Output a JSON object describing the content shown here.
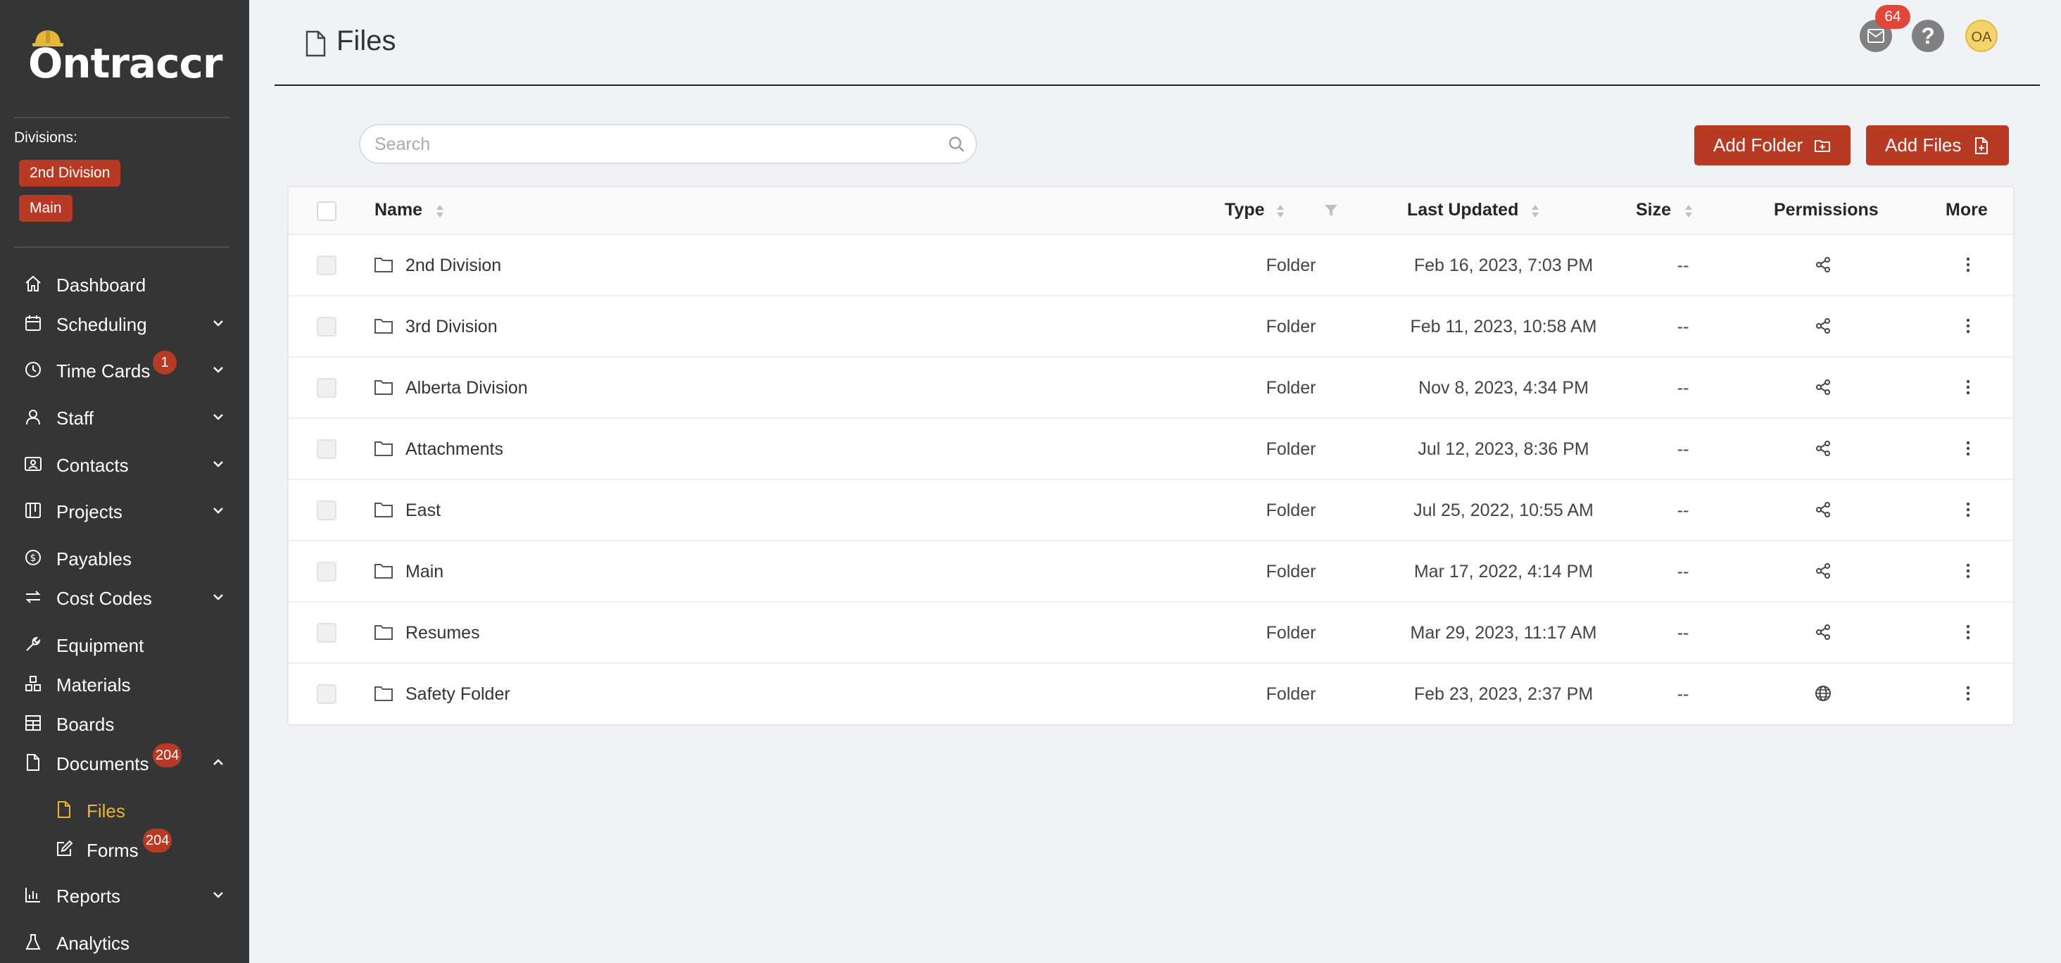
{
  "app": {
    "logo_text": "Ontraccr"
  },
  "sidebar": {
    "divisions_label": "Divisions:",
    "division_tags": [
      "2nd Division",
      "Main"
    ],
    "items": [
      {
        "label": "Dashboard",
        "icon": "home-icon"
      },
      {
        "label": "Scheduling",
        "icon": "calendar-icon"
      },
      {
        "label": "Time Cards",
        "icon": "clock-icon",
        "badge": "1"
      },
      {
        "label": "Staff",
        "icon": "user-icon"
      },
      {
        "label": "Contacts",
        "icon": "contacts-icon"
      },
      {
        "label": "Projects",
        "icon": "projects-icon"
      },
      {
        "label": "Payables",
        "icon": "dollar-icon"
      },
      {
        "label": "Cost Codes",
        "icon": "swap-icon"
      },
      {
        "label": "Equipment",
        "icon": "wrench-icon"
      },
      {
        "label": "Materials",
        "icon": "materials-icon"
      },
      {
        "label": "Boards",
        "icon": "boards-icon"
      },
      {
        "label": "Documents",
        "icon": "document-icon",
        "badge": "204"
      },
      {
        "label": "Files",
        "icon": "file-icon",
        "active": true
      },
      {
        "label": "Forms",
        "icon": "edit-form-icon",
        "badge": "204"
      },
      {
        "label": "Reports",
        "icon": "bar-chart-icon"
      },
      {
        "label": "Analytics",
        "icon": "flask-icon"
      }
    ]
  },
  "header": {
    "title": "Files",
    "mail_badge": "64",
    "help_label": "?",
    "avatar_initials": "OA"
  },
  "toolbar": {
    "search_placeholder": "Search",
    "search_value": "",
    "add_folder_label": "Add Folder",
    "add_files_label": "Add Files"
  },
  "table": {
    "columns": {
      "name": "Name",
      "type": "Type",
      "last_updated": "Last Updated",
      "size": "Size",
      "permissions": "Permissions",
      "more": "More"
    },
    "rows": [
      {
        "name": "2nd Division",
        "type": "Folder",
        "last_updated": "Feb 16, 2023, 7:03 PM",
        "size": "--",
        "permission": "share-icon"
      },
      {
        "name": "3rd Division",
        "type": "Folder",
        "last_updated": "Feb 11, 2023, 10:58 AM",
        "size": "--",
        "permission": "share-icon"
      },
      {
        "name": "Alberta Division",
        "type": "Folder",
        "last_updated": "Nov 8, 2023, 4:34 PM",
        "size": "--",
        "permission": "share-icon"
      },
      {
        "name": "Attachments",
        "type": "Folder",
        "last_updated": "Jul 12, 2023, 8:36 PM",
        "size": "--",
        "permission": "share-icon"
      },
      {
        "name": "East",
        "type": "Folder",
        "last_updated": "Jul 25, 2022, 10:55 AM",
        "size": "--",
        "permission": "share-icon"
      },
      {
        "name": "Main",
        "type": "Folder",
        "last_updated": "Mar 17, 2022, 4:14 PM",
        "size": "--",
        "permission": "share-icon"
      },
      {
        "name": "Resumes",
        "type": "Folder",
        "last_updated": "Mar 29, 2023, 11:17 AM",
        "size": "--",
        "permission": "share-icon"
      },
      {
        "name": "Safety Folder",
        "type": "Folder",
        "last_updated": "Feb 23, 2023, 2:37 PM",
        "size": "--",
        "permission": "globe-icon"
      }
    ]
  },
  "colors": {
    "sidebar_bg": "#353535",
    "accent": "#b73a24",
    "active_nav": "#e6b53a",
    "page_bg": "#f0f2f5"
  }
}
